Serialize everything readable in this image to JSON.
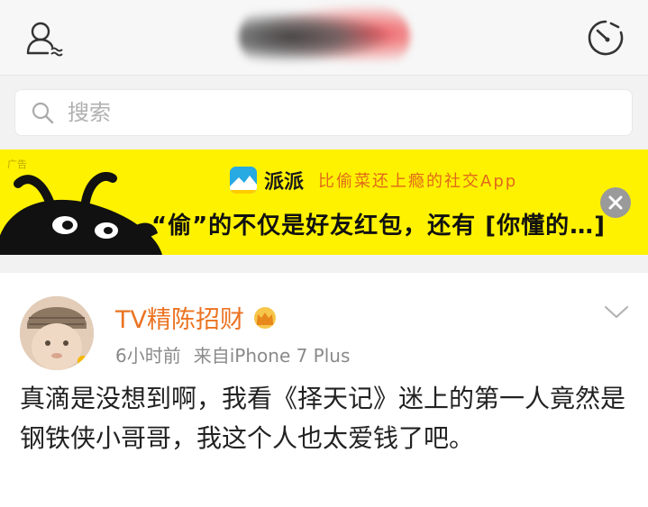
{
  "search": {
    "placeholder": "搜索"
  },
  "ad": {
    "tag": "广告",
    "brand_name": "派派",
    "tagline": "比偷菜还上瘾的社交App",
    "headline": "“偷”的不仅是好友红包，还有 [你懂的…]",
    "accent_color": "#fff200"
  },
  "post": {
    "username": "TV精陈招财",
    "time": "6小时前",
    "source": "来自iPhone 7 Plus",
    "text": "真滴是没想到啊，我看《择天记》迷上的第一人竟然是钢铁侠小哥哥，我这个人也太爱钱了吧。",
    "username_color": "#eb7322"
  },
  "icons": [
    "user-friends-icon",
    "radar-icon",
    "search-icon",
    "close-icon",
    "crown-icon",
    "chevron-down-icon"
  ]
}
